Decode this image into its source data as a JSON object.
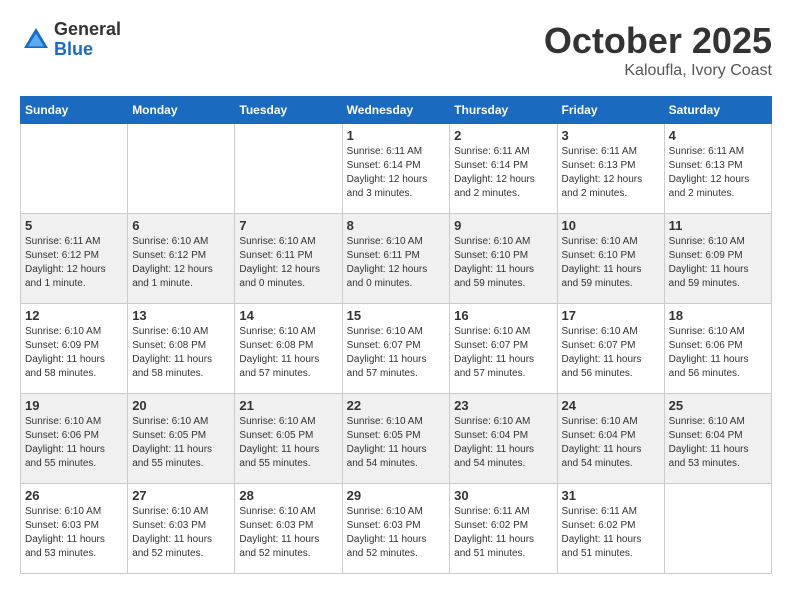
{
  "header": {
    "logo_general": "General",
    "logo_blue": "Blue",
    "month_title": "October 2025",
    "location": "Kaloufla, Ivory Coast"
  },
  "weekdays": [
    "Sunday",
    "Monday",
    "Tuesday",
    "Wednesday",
    "Thursday",
    "Friday",
    "Saturday"
  ],
  "weeks": [
    [
      {
        "day": "",
        "sunrise": "",
        "sunset": "",
        "daylight": ""
      },
      {
        "day": "",
        "sunrise": "",
        "sunset": "",
        "daylight": ""
      },
      {
        "day": "",
        "sunrise": "",
        "sunset": "",
        "daylight": ""
      },
      {
        "day": "1",
        "sunrise": "Sunrise: 6:11 AM",
        "sunset": "Sunset: 6:14 PM",
        "daylight": "Daylight: 12 hours and 3 minutes."
      },
      {
        "day": "2",
        "sunrise": "Sunrise: 6:11 AM",
        "sunset": "Sunset: 6:14 PM",
        "daylight": "Daylight: 12 hours and 2 minutes."
      },
      {
        "day": "3",
        "sunrise": "Sunrise: 6:11 AM",
        "sunset": "Sunset: 6:13 PM",
        "daylight": "Daylight: 12 hours and 2 minutes."
      },
      {
        "day": "4",
        "sunrise": "Sunrise: 6:11 AM",
        "sunset": "Sunset: 6:13 PM",
        "daylight": "Daylight: 12 hours and 2 minutes."
      }
    ],
    [
      {
        "day": "5",
        "sunrise": "Sunrise: 6:11 AM",
        "sunset": "Sunset: 6:12 PM",
        "daylight": "Daylight: 12 hours and 1 minute."
      },
      {
        "day": "6",
        "sunrise": "Sunrise: 6:10 AM",
        "sunset": "Sunset: 6:12 PM",
        "daylight": "Daylight: 12 hours and 1 minute."
      },
      {
        "day": "7",
        "sunrise": "Sunrise: 6:10 AM",
        "sunset": "Sunset: 6:11 PM",
        "daylight": "Daylight: 12 hours and 0 minutes."
      },
      {
        "day": "8",
        "sunrise": "Sunrise: 6:10 AM",
        "sunset": "Sunset: 6:11 PM",
        "daylight": "Daylight: 12 hours and 0 minutes."
      },
      {
        "day": "9",
        "sunrise": "Sunrise: 6:10 AM",
        "sunset": "Sunset: 6:10 PM",
        "daylight": "Daylight: 11 hours and 59 minutes."
      },
      {
        "day": "10",
        "sunrise": "Sunrise: 6:10 AM",
        "sunset": "Sunset: 6:10 PM",
        "daylight": "Daylight: 11 hours and 59 minutes."
      },
      {
        "day": "11",
        "sunrise": "Sunrise: 6:10 AM",
        "sunset": "Sunset: 6:09 PM",
        "daylight": "Daylight: 11 hours and 59 minutes."
      }
    ],
    [
      {
        "day": "12",
        "sunrise": "Sunrise: 6:10 AM",
        "sunset": "Sunset: 6:09 PM",
        "daylight": "Daylight: 11 hours and 58 minutes."
      },
      {
        "day": "13",
        "sunrise": "Sunrise: 6:10 AM",
        "sunset": "Sunset: 6:08 PM",
        "daylight": "Daylight: 11 hours and 58 minutes."
      },
      {
        "day": "14",
        "sunrise": "Sunrise: 6:10 AM",
        "sunset": "Sunset: 6:08 PM",
        "daylight": "Daylight: 11 hours and 57 minutes."
      },
      {
        "day": "15",
        "sunrise": "Sunrise: 6:10 AM",
        "sunset": "Sunset: 6:07 PM",
        "daylight": "Daylight: 11 hours and 57 minutes."
      },
      {
        "day": "16",
        "sunrise": "Sunrise: 6:10 AM",
        "sunset": "Sunset: 6:07 PM",
        "daylight": "Daylight: 11 hours and 57 minutes."
      },
      {
        "day": "17",
        "sunrise": "Sunrise: 6:10 AM",
        "sunset": "Sunset: 6:07 PM",
        "daylight": "Daylight: 11 hours and 56 minutes."
      },
      {
        "day": "18",
        "sunrise": "Sunrise: 6:10 AM",
        "sunset": "Sunset: 6:06 PM",
        "daylight": "Daylight: 11 hours and 56 minutes."
      }
    ],
    [
      {
        "day": "19",
        "sunrise": "Sunrise: 6:10 AM",
        "sunset": "Sunset: 6:06 PM",
        "daylight": "Daylight: 11 hours and 55 minutes."
      },
      {
        "day": "20",
        "sunrise": "Sunrise: 6:10 AM",
        "sunset": "Sunset: 6:05 PM",
        "daylight": "Daylight: 11 hours and 55 minutes."
      },
      {
        "day": "21",
        "sunrise": "Sunrise: 6:10 AM",
        "sunset": "Sunset: 6:05 PM",
        "daylight": "Daylight: 11 hours and 55 minutes."
      },
      {
        "day": "22",
        "sunrise": "Sunrise: 6:10 AM",
        "sunset": "Sunset: 6:05 PM",
        "daylight": "Daylight: 11 hours and 54 minutes."
      },
      {
        "day": "23",
        "sunrise": "Sunrise: 6:10 AM",
        "sunset": "Sunset: 6:04 PM",
        "daylight": "Daylight: 11 hours and 54 minutes."
      },
      {
        "day": "24",
        "sunrise": "Sunrise: 6:10 AM",
        "sunset": "Sunset: 6:04 PM",
        "daylight": "Daylight: 11 hours and 54 minutes."
      },
      {
        "day": "25",
        "sunrise": "Sunrise: 6:10 AM",
        "sunset": "Sunset: 6:04 PM",
        "daylight": "Daylight: 11 hours and 53 minutes."
      }
    ],
    [
      {
        "day": "26",
        "sunrise": "Sunrise: 6:10 AM",
        "sunset": "Sunset: 6:03 PM",
        "daylight": "Daylight: 11 hours and 53 minutes."
      },
      {
        "day": "27",
        "sunrise": "Sunrise: 6:10 AM",
        "sunset": "Sunset: 6:03 PM",
        "daylight": "Daylight: 11 hours and 52 minutes."
      },
      {
        "day": "28",
        "sunrise": "Sunrise: 6:10 AM",
        "sunset": "Sunset: 6:03 PM",
        "daylight": "Daylight: 11 hours and 52 minutes."
      },
      {
        "day": "29",
        "sunrise": "Sunrise: 6:10 AM",
        "sunset": "Sunset: 6:03 PM",
        "daylight": "Daylight: 11 hours and 52 minutes."
      },
      {
        "day": "30",
        "sunrise": "Sunrise: 6:11 AM",
        "sunset": "Sunset: 6:02 PM",
        "daylight": "Daylight: 11 hours and 51 minutes."
      },
      {
        "day": "31",
        "sunrise": "Sunrise: 6:11 AM",
        "sunset": "Sunset: 6:02 PM",
        "daylight": "Daylight: 11 hours and 51 minutes."
      },
      {
        "day": "",
        "sunrise": "",
        "sunset": "",
        "daylight": ""
      }
    ]
  ]
}
